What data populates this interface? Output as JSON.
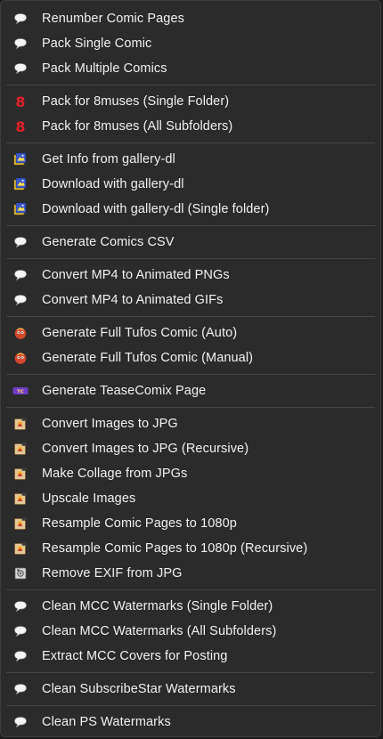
{
  "groups": [
    {
      "items": [
        {
          "label": "Renumber Comic Pages",
          "icon": "speech-bubble-icon"
        },
        {
          "label": "Pack Single Comic",
          "icon": "speech-bubble-icon"
        },
        {
          "label": "Pack Multiple Comics",
          "icon": "speech-bubble-icon"
        }
      ]
    },
    {
      "items": [
        {
          "label": "Pack for 8muses (Single Folder)",
          "icon": "8muses-icon"
        },
        {
          "label": "Pack for 8muses (All Subfolders)",
          "icon": "8muses-icon"
        }
      ]
    },
    {
      "items": [
        {
          "label": "Get Info from gallery-dl",
          "icon": "gallery-dl-icon"
        },
        {
          "label": "Download with gallery-dl",
          "icon": "gallery-dl-icon"
        },
        {
          "label": "Download with gallery-dl (Single folder)",
          "icon": "gallery-dl-icon"
        }
      ]
    },
    {
      "items": [
        {
          "label": "Generate Comics CSV",
          "icon": "speech-bubble-icon"
        }
      ]
    },
    {
      "items": [
        {
          "label": "Convert MP4 to Animated PNGs",
          "icon": "speech-bubble-icon"
        },
        {
          "label": "Convert MP4 to Animated GIFs",
          "icon": "speech-bubble-icon"
        }
      ]
    },
    {
      "items": [
        {
          "label": "Generate Full Tufos Comic (Auto)",
          "icon": "tufos-icon"
        },
        {
          "label": "Generate Full Tufos Comic (Manual)",
          "icon": "tufos-icon"
        }
      ]
    },
    {
      "items": [
        {
          "label": "Generate TeaseComix Page",
          "icon": "teasecomix-icon"
        }
      ]
    },
    {
      "items": [
        {
          "label": "Convert Images to JPG",
          "icon": "image-tool-icon"
        },
        {
          "label": "Convert Images to JPG (Recursive)",
          "icon": "image-tool-icon"
        },
        {
          "label": "Make Collage from JPGs",
          "icon": "image-tool-icon"
        },
        {
          "label": "Upscale Images",
          "icon": "image-tool-icon"
        },
        {
          "label": "Resample Comic Pages to 1080p",
          "icon": "image-tool-icon"
        },
        {
          "label": "Resample Comic Pages to 1080p (Recursive)",
          "icon": "image-tool-icon"
        },
        {
          "label": "Remove EXIF from JPG",
          "icon": "exif-icon"
        }
      ]
    },
    {
      "items": [
        {
          "label": "Clean MCC Watermarks (Single Folder)",
          "icon": "speech-bubble-icon"
        },
        {
          "label": "Clean MCC Watermarks (All Subfolders)",
          "icon": "speech-bubble-icon"
        },
        {
          "label": "Extract MCC Covers for Posting",
          "icon": "speech-bubble-icon"
        }
      ]
    },
    {
      "items": [
        {
          "label": "Clean SubscribeStar Watermarks",
          "icon": "speech-bubble-icon"
        }
      ]
    },
    {
      "items": [
        {
          "label": "Clean PS Watermarks",
          "icon": "speech-bubble-icon"
        }
      ]
    }
  ]
}
